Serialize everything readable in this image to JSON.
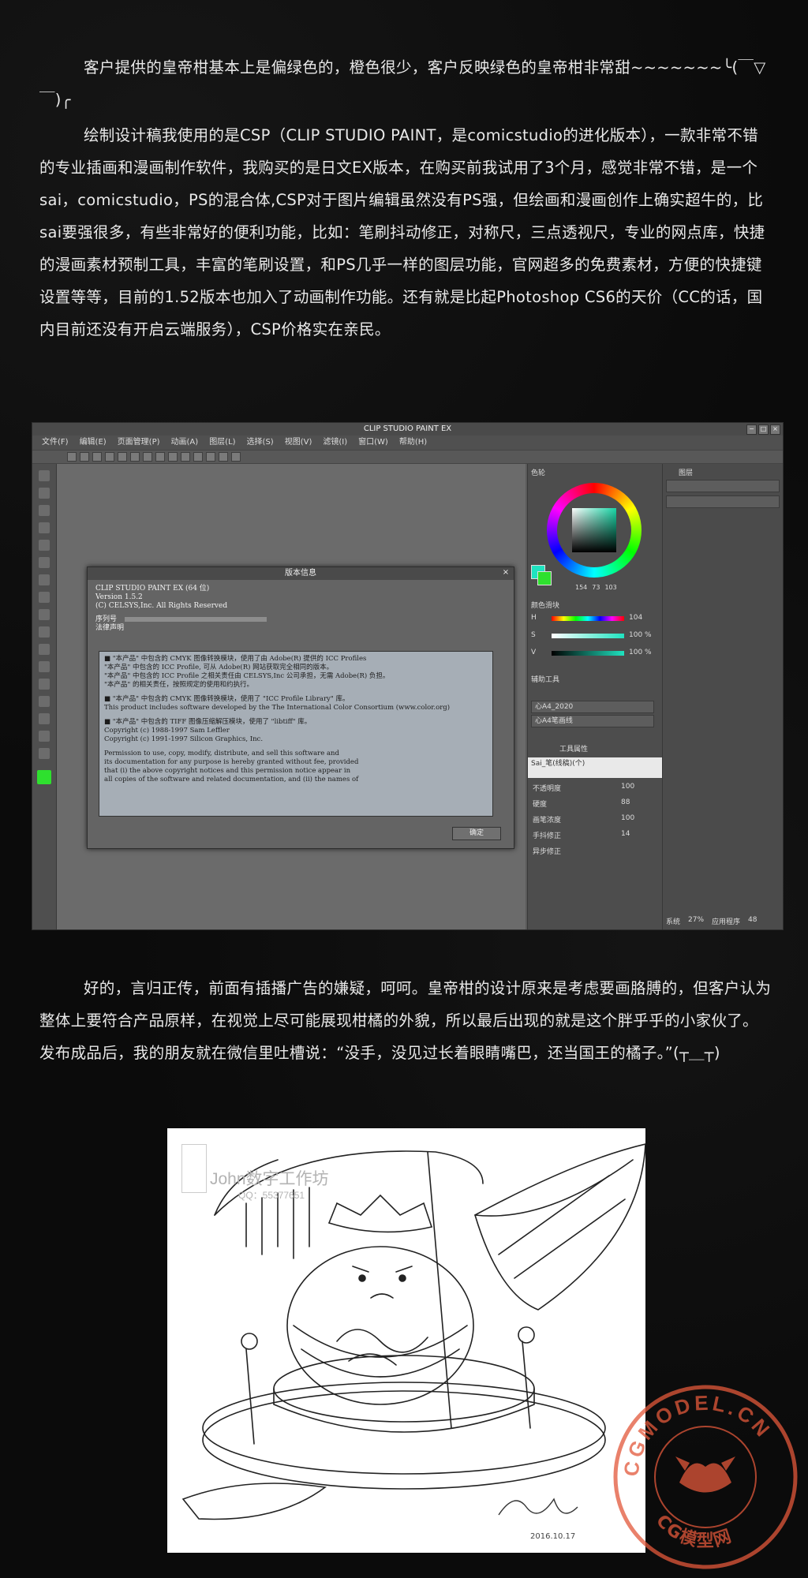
{
  "intro": {
    "line1": "客户提供的皇帝柑基本上是偏绿色的，橙色很少，客户反映绿色的皇帝柑非常甜~~~~~~~╰(￣▽￣)╭",
    "para2": "绘制设计稿我使用的是CSP（CLIP STUDIO PAINT，是comicstudio的进化版本），一款非常不错的专业插画和漫画制作软件，我购买的是日文EX版本，在购买前我试用了3个月，感觉非常不错，是一个sai，comicstudio，PS的混合体,CSP对于图片编辑虽然没有PS强，但绘画和漫画创作上确实超牛的，比sai要强很多，有些非常好的便利功能，比如：笔刷抖动修正，对称尺，三点透视尺，专业的网点库，快捷的漫画素材预制工具，丰富的笔刷设置，和PS几乎一样的图层功能，官网超多的免费素材，方便的快捷键设置等等，目前的1.52版本也加入了动画制作功能。还有就是比起Photoshop CS6的天价（CC的话，国内目前还没有开启云端服务），CSP价格实在亲民。"
  },
  "csp": {
    "window_title": "CLIP STUDIO PAINT EX",
    "menu": [
      "文件(F)",
      "编辑(E)",
      "页面管理(P)",
      "动画(A)",
      "图层(L)",
      "选择(S)",
      "视图(V)",
      "滤镜(I)",
      "窗口(W)",
      "帮助(H)"
    ],
    "dialog": {
      "title": "版本信息",
      "close": "×",
      "product": "CLIP STUDIO PAINT EX (64 位)",
      "version": "Version 1.5.2",
      "copyright": "(C) CELSYS,Inc. All Rights Reserved",
      "serial_label": "序列号",
      "legal_label": "法律声明",
      "license_text": [
        "■ \"本产品\" 中包含的 CMYK 图像转换模块，使用了由 Adobe(R) 提供的 ICC Profiles\n\"本产品\" 中包含的 ICC Profile, 可从 Adobe(R) 网站获取完全相同的版本。\n\"本产品\" 中包含的 ICC Profile 之相关责任由 CELSYS,Inc 公司承担，无需 Adobe(R) 负担。\n\"本产品\" 的相关责任，按照规定的使用和约执行。",
        "■ \"本产品\" 中包含的 CMYK 图像转换模块，使用了 \"ICC Profile Library\" 库。\nThis product includes software developed by the The International Color Consortium (www.color.org)",
        "■ \"本产品\" 中包含的 TIFF 图像压缩解压模块，使用了 \"libtiff\" 库。\nCopyright (c) 1988-1997 Sam Leffler\nCopyright (c) 1991-1997 Silicon Graphics, Inc.",
        "Permission to use, copy, modify, distribute, and sell this software and\nits documentation for any purpose is hereby granted without fee, provided\nthat (i) the above copyright notices and this permission notice appear in\nall copies of the software and related documentation, and (ii) the names of"
      ],
      "ok_label": "确定"
    },
    "panels": {
      "color_tab": "色轮",
      "hsv_values": [
        "154",
        "73",
        "103"
      ],
      "slider_tab": "颜色滑块",
      "slider_rows": [
        {
          "label": "H",
          "value": "104"
        },
        {
          "label": "S",
          "value": "100 %"
        },
        {
          "label": "V",
          "value": "100 %"
        }
      ],
      "subtool_tab": "辅助工具",
      "subtool_items": [
        "心A4_2020",
        "心A4笔画线"
      ],
      "tool_property_tab": "工具属性",
      "tool_property_header": "Sai_笔(线稿)(个)",
      "tool_props": [
        {
          "label": "不透明度",
          "value": "100"
        },
        {
          "label": "硬度",
          "value": "88"
        },
        {
          "label": "画笔浓度",
          "value": "100"
        },
        {
          "label": "手抖修正",
          "value": "14"
        },
        {
          "label": "异步修正",
          "value": ""
        }
      ],
      "layer_tab": "图层",
      "status_zoom": "27%",
      "status_app": "应用程序",
      "status_mem": "48",
      "status_system": "系统"
    },
    "colors": {
      "main": "#1fe3c0",
      "sub": "#2ee02e"
    }
  },
  "story": {
    "para": "好的，言归正传，前面有插播广告的嫌疑，呵呵。皇帝柑的设计原来是考虑要画胳膊的，但客户认为整体上要符合产品原样，在视觉上尽可能展现柑橘的外貌，所以最后出现的就是这个胖乎乎的小家伙了。发布成品后，我的朋友就在微信里吐槽说：“没手，没见过长着眼睛嘴巴，还当国王的橘子。”(┬＿┬)"
  },
  "sketch": {
    "watermark_name": "John数字工作坊",
    "watermark_qq": "QQ：55377651",
    "signature_date": "2016.10.17"
  },
  "seal": {
    "top_text": "CGMODEL.CN",
    "bottom_text": "CG模型网",
    "color": "#e2583a"
  }
}
